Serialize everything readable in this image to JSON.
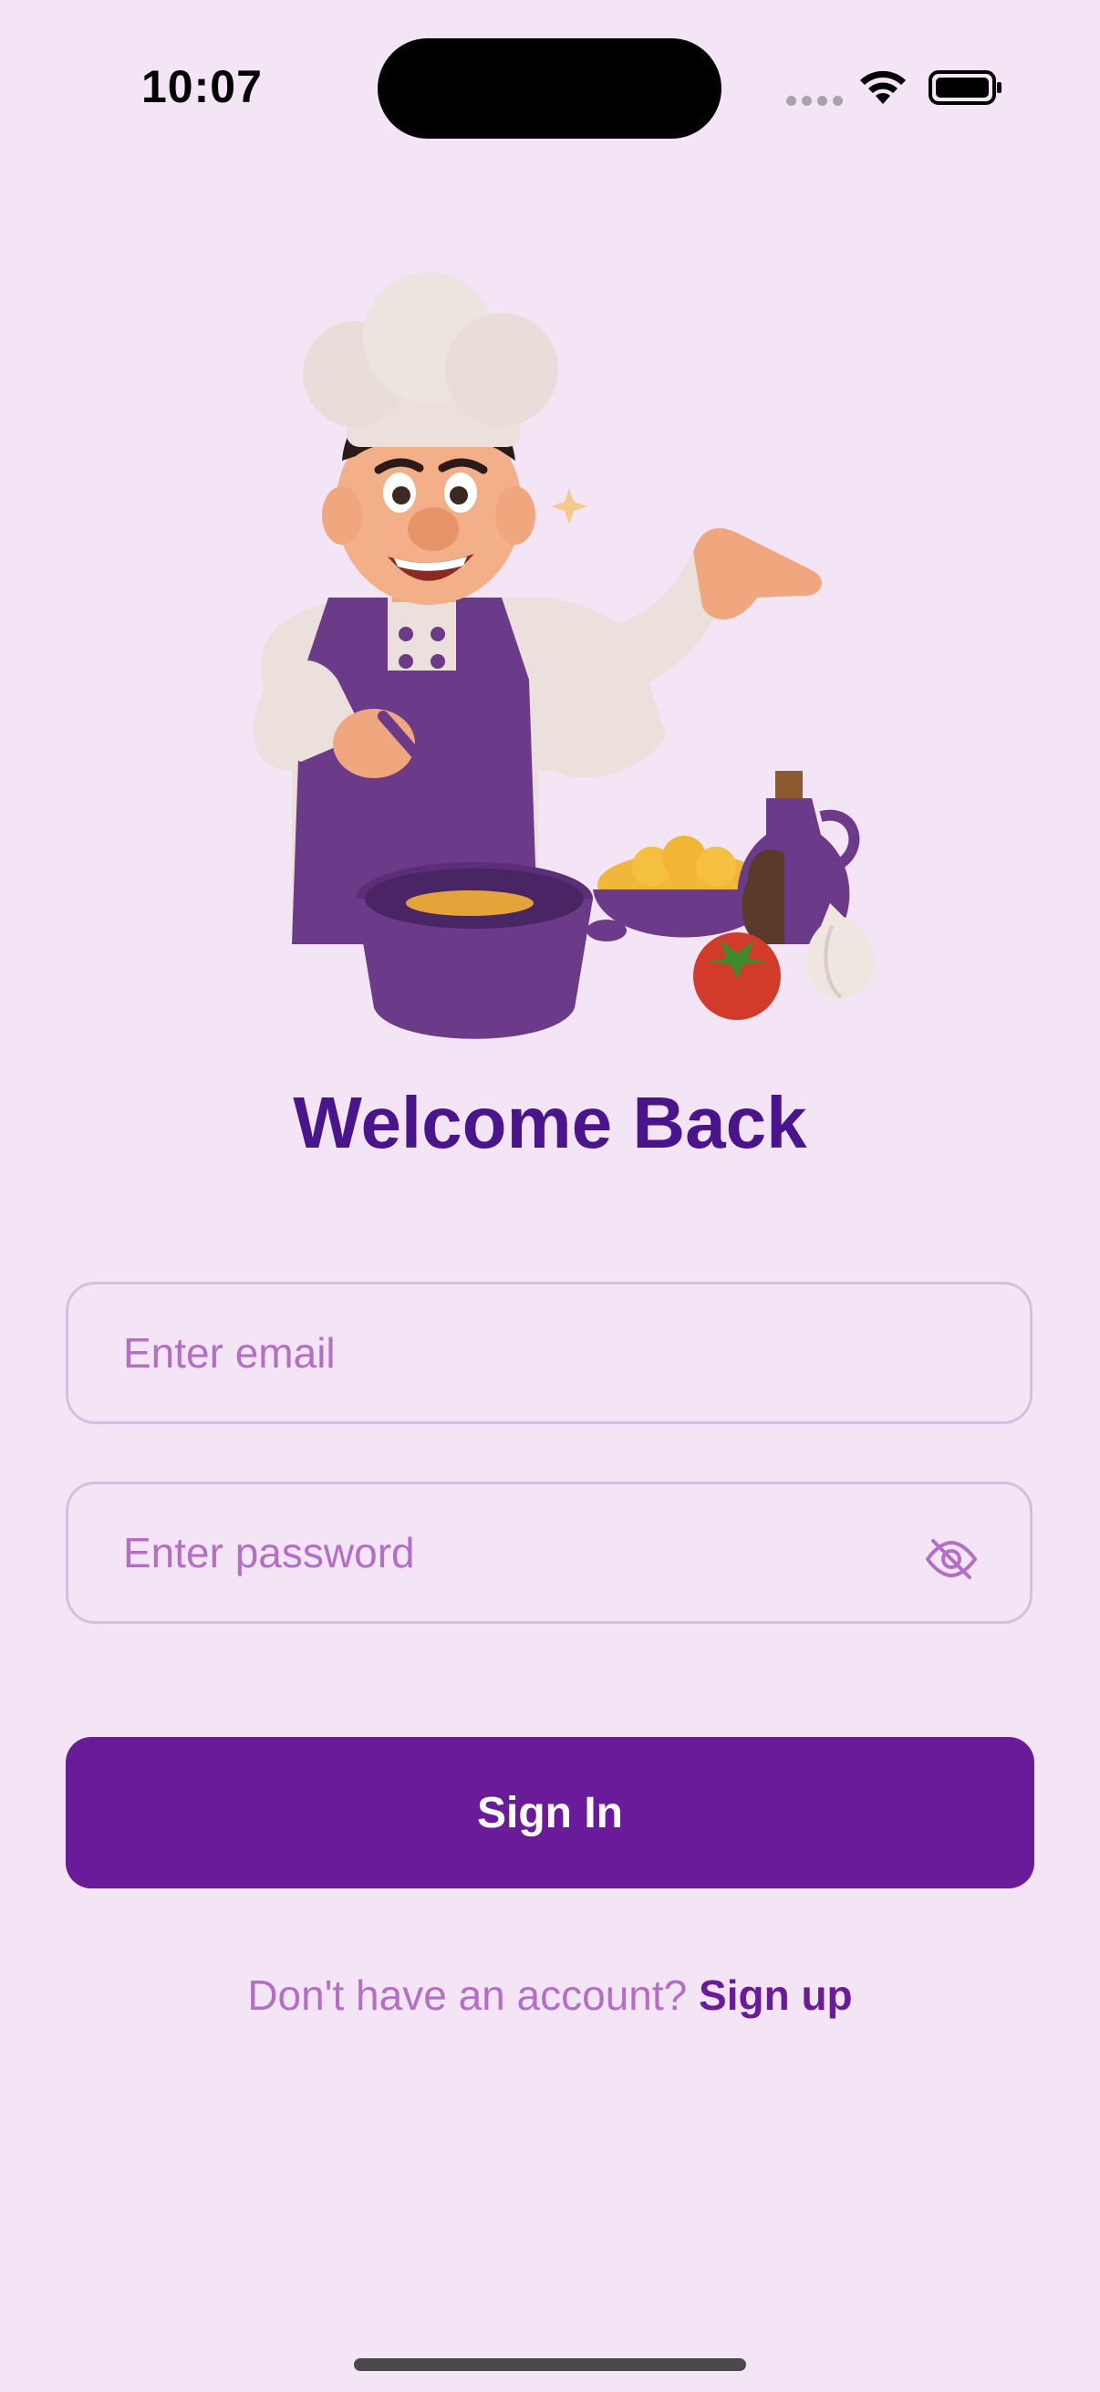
{
  "status_bar": {
    "time": "10:07"
  },
  "login": {
    "title": "Welcome Back",
    "email_placeholder": "Enter email",
    "password_placeholder": "Enter password",
    "sign_in_label": "Sign In",
    "signup_prompt": "Don't have an account?",
    "signup_link": "Sign up"
  },
  "icons": {
    "wifi": "wifi-icon",
    "battery": "battery-icon",
    "password_toggle": "eye-slash-icon"
  },
  "colors": {
    "background": "#f3e5f5",
    "primary": "#6a1b9a",
    "title": "#4a148c",
    "placeholder": "#b46ec6",
    "field_border": "#d4bfdf"
  }
}
